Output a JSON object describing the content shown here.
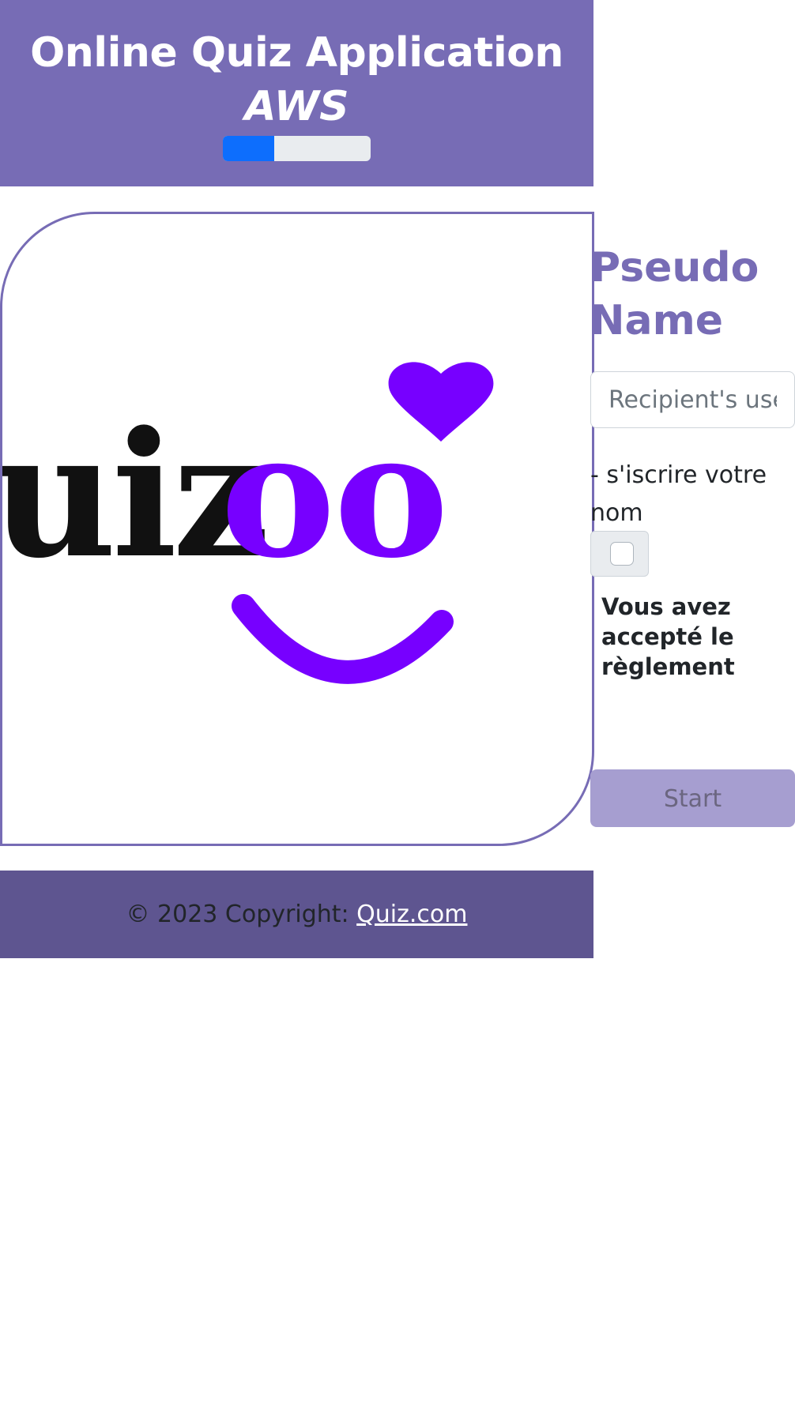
{
  "header": {
    "title": "Online Quiz Application",
    "subtitle": "AWS",
    "progress_fraction": 0.35
  },
  "logo": {
    "text_dark": "uiz",
    "text_accent": "oo",
    "accent_color": "#7700ff",
    "dark_color": "#111111"
  },
  "form": {
    "title_line1": "Pseudo",
    "title_line2": "Name",
    "input_placeholder": "Recipient's username",
    "input_value": "",
    "hint": "- s'iscrire votre nom",
    "checkbox_checked": false,
    "checkbox_label": "Vous avez accepté le règlement",
    "start_label": "Start"
  },
  "footer": {
    "copyright": "© 2023 Copyright: ",
    "link_text": "Quiz.com"
  },
  "colors": {
    "brand": "#776cb5",
    "footer_bg": "#5e5590",
    "progress": "#0d6efd",
    "button_disabled": "#a69ed0"
  }
}
